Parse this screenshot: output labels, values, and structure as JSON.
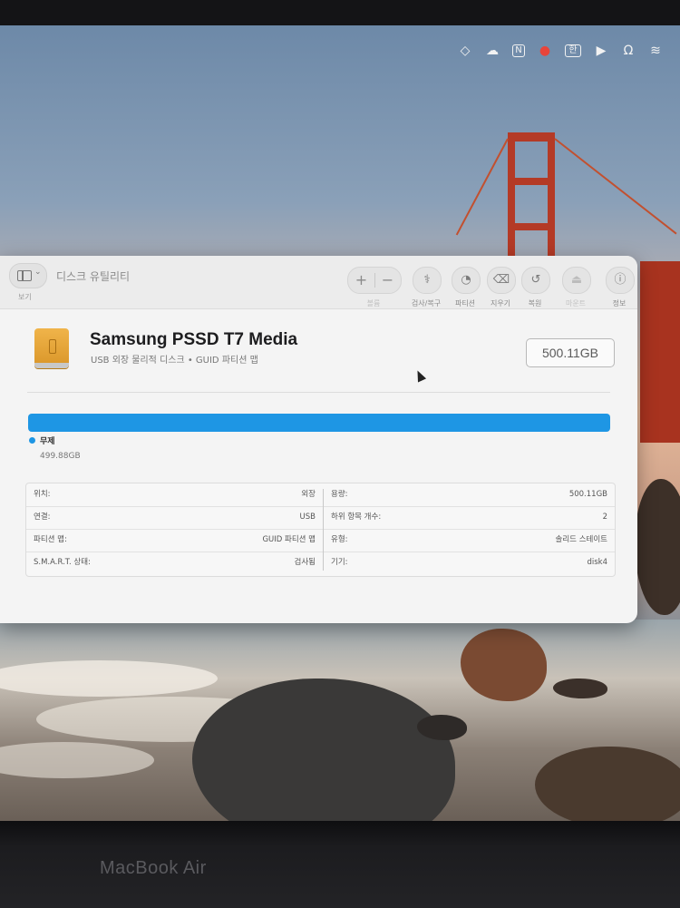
{
  "menubar": {
    "icons": [
      "diamond-icon",
      "cloud-icon",
      "notion-icon",
      "record-icon",
      "input-method-icon",
      "play-icon",
      "headphones-icon",
      "wifi-icon"
    ],
    "input_method": "한"
  },
  "window": {
    "app_title": "디스크 유틸리티",
    "view_label": "보기",
    "toolbar": {
      "plus": "+",
      "minus": "−",
      "volume_label": "볼륨",
      "firstaid_label": "검사/복구",
      "partition_label": "파티션",
      "erase_label": "지우기",
      "restore_label": "복원",
      "unmount_label": "마운트",
      "info_label": "정보"
    },
    "disk": {
      "name": "Samsung PSSD T7 Media",
      "subtitle": "USB 외장 물리적 디스크 • GUID 파티션 맵",
      "capacity": "500.11GB"
    },
    "usage": {
      "legend_label": "무제",
      "legend_value": "499.88GB",
      "fill_fraction": 1.0,
      "color": "#1e96e4"
    },
    "details_left": [
      {
        "key": "위치:",
        "value": "외장"
      },
      {
        "key": "연결:",
        "value": "USB"
      },
      {
        "key": "파티션 맵:",
        "value": "GUID 파티션 맵"
      },
      {
        "key": "S.M.A.R.T. 상태:",
        "value": "검사됨"
      }
    ],
    "details_right": [
      {
        "key": "용량:",
        "value": "500.11GB"
      },
      {
        "key": "하위 항목 개수:",
        "value": "2"
      },
      {
        "key": "유형:",
        "value": "솔리드 스테이트"
      },
      {
        "key": "기기:",
        "value": "disk4"
      }
    ]
  },
  "bezel": {
    "label": "MacBook Air"
  }
}
